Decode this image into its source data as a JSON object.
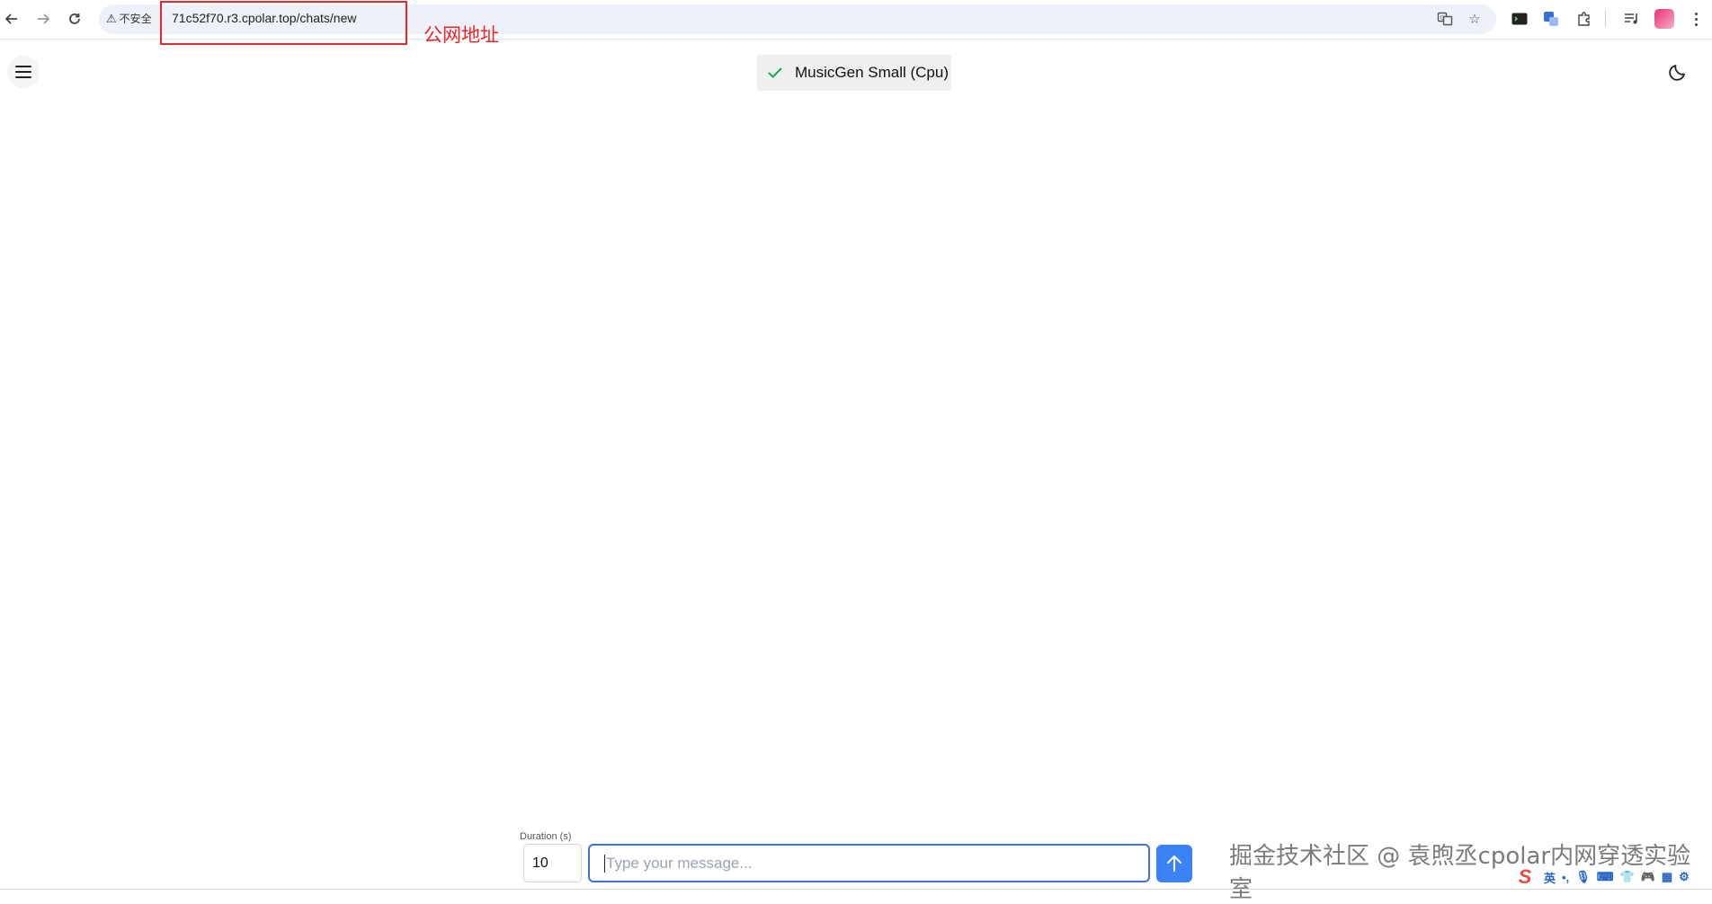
{
  "browser": {
    "security_label": "不安全",
    "url": "71c52f70.r3.cpolar.top/chats/new",
    "annotation": "公网地址"
  },
  "app": {
    "model_label": "MusicGen Small (Cpu)"
  },
  "composer": {
    "duration_label": "Duration (s)",
    "duration_value": "10",
    "message_placeholder": "Type your message..."
  },
  "watermark": "掘金技术社区 @ 袁煦丞cpolar内网穿透实验室",
  "ime": {
    "mode": "英"
  },
  "colors": {
    "annotation_red": "#e8262b",
    "send_blue": "#3b82f6",
    "input_border": "#3f6fd8",
    "check_green": "#1fa855"
  }
}
